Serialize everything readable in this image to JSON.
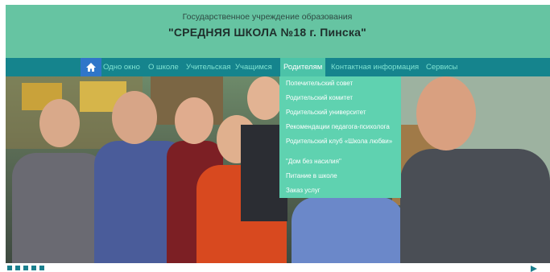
{
  "header": {
    "subtitle": "Государственное учреждение образования",
    "title": "\"СРЕДНЯЯ ШКОЛА №18 г. Пинска\""
  },
  "nav": {
    "items": [
      {
        "label": "Одно окно"
      },
      {
        "label": "О школе"
      },
      {
        "label": "Учительская"
      },
      {
        "label": "Учащимся"
      },
      {
        "label": "Родителям",
        "active": true
      },
      {
        "label": "Контактная информация"
      },
      {
        "label": "Сервисы"
      }
    ]
  },
  "dropdown": {
    "items": [
      "Попечительский совет",
      "Родительский комитет",
      "Родительский университет",
      "Рекомендации педагога-психолога",
      "Родительский клуб «Школа любви»",
      "\"Дом без насилия\"",
      "Питание в школе",
      "Заказ услуг"
    ]
  },
  "colors": {
    "header_bg": "#66c4a2",
    "nav_bg": "#15848d",
    "dropdown_bg": "#5fd2b0",
    "home_bg": "#2f76c9"
  }
}
